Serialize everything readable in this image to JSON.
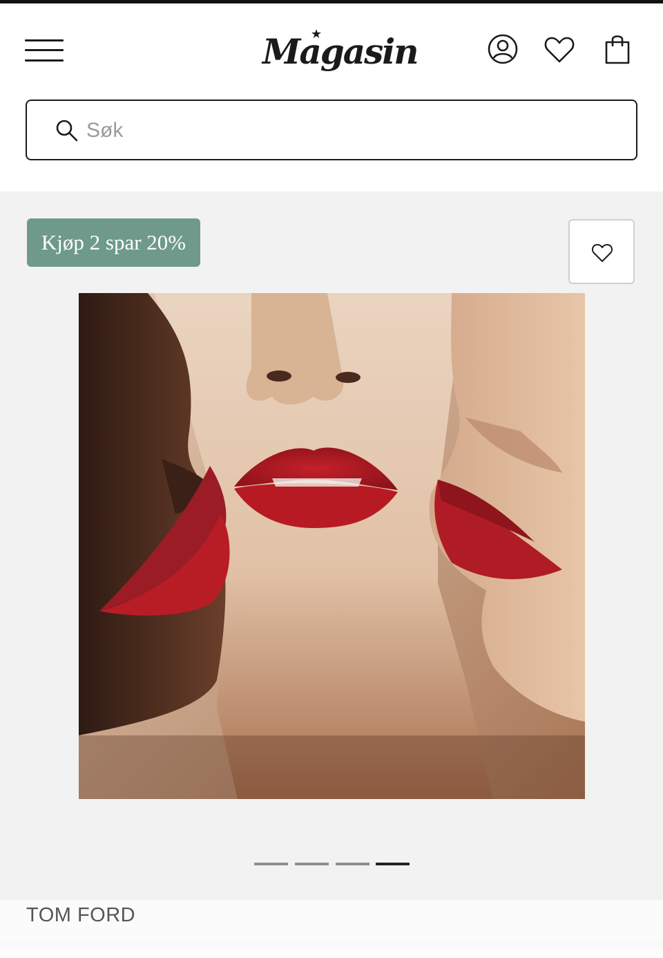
{
  "header": {
    "logo_text": "Magasin",
    "logo_star": "★",
    "icons": [
      "menu-icon",
      "account-icon",
      "heart-icon",
      "shopping-bag-icon"
    ]
  },
  "search": {
    "placeholder": "Søk",
    "value": ""
  },
  "product": {
    "badge": "Kjøp 2 spar 20%",
    "badge_color": "#6f9a8b",
    "carousel": {
      "slide_count": 4,
      "active_index": 3
    },
    "brand": "TOM FORD"
  }
}
